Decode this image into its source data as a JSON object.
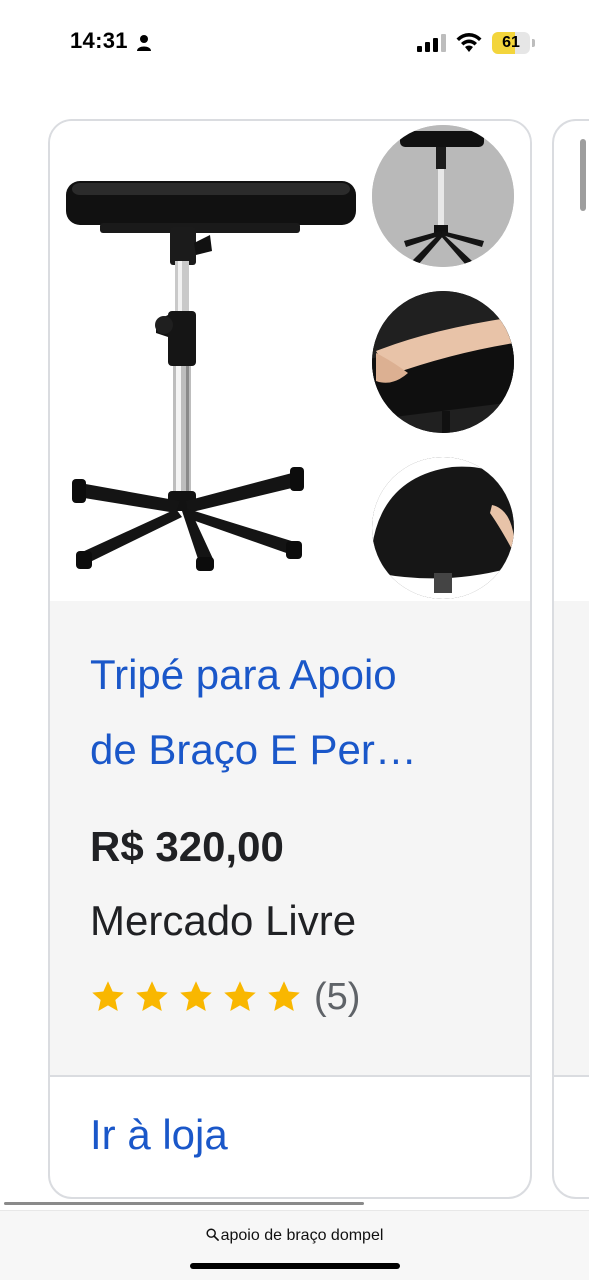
{
  "status_bar": {
    "time": "14:31",
    "battery_level": "61",
    "battery_color": "#f3d53c"
  },
  "product": {
    "title_line1": "Tripé para Apoio",
    "title_line2": "de Braço E Per…",
    "price": "R$ 320,00",
    "store": "Mercado Livre",
    "rating_stars": 5,
    "rating_count": "(5)",
    "store_link": "Ir à loja",
    "link_color": "#1a57c9",
    "star_color": "#f9b700"
  },
  "address_bar": {
    "query": "apoio de braço dompel",
    "icon": "search-icon"
  }
}
